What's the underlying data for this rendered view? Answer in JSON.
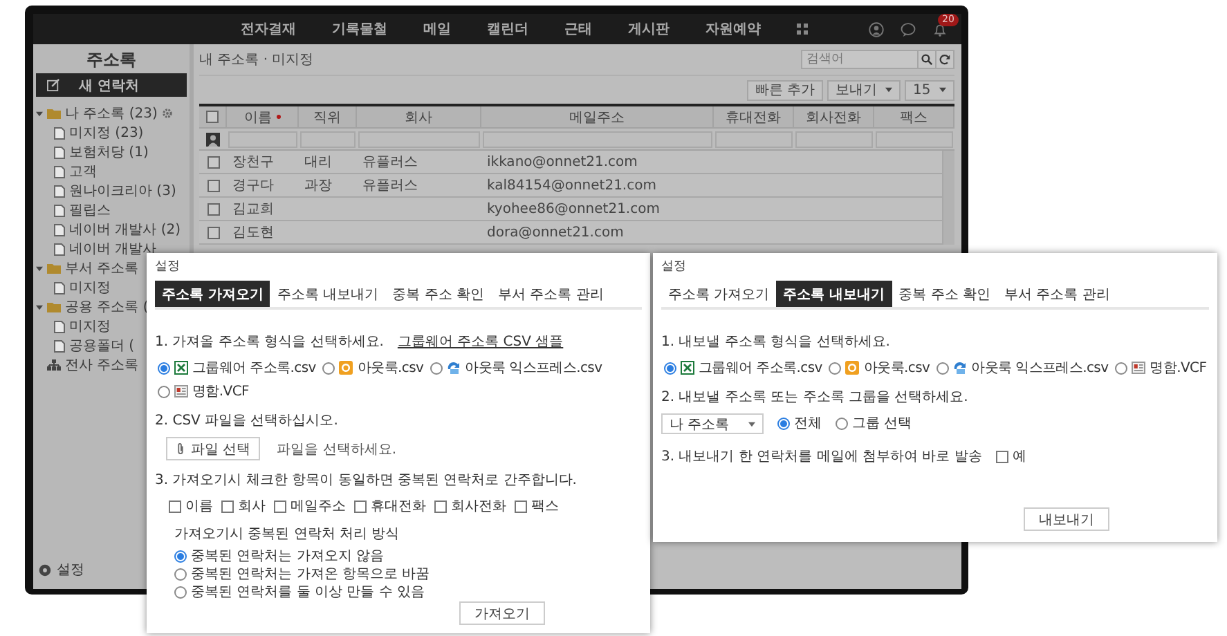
{
  "nav": {
    "items": [
      "전자결재",
      "기록물철",
      "메일",
      "캘린더",
      "근태",
      "게시판",
      "자원예약"
    ],
    "badge": "20"
  },
  "sidebar": {
    "title": "주소록",
    "new_button": "새 연락처",
    "tree": [
      {
        "label": "나 주소록 (23)",
        "kind": "folder",
        "expanded": true,
        "settings": true,
        "children": [
          {
            "label": "미지정 (23)"
          },
          {
            "label": "보험처당 (1)"
          },
          {
            "label": "고객"
          },
          {
            "label": "원나이크리아 (3)"
          },
          {
            "label": "필립스"
          },
          {
            "label": "네이버 개발사 (2)"
          },
          {
            "label": "네이버 개발사"
          }
        ]
      },
      {
        "label": "부서 주소록",
        "kind": "folder",
        "expanded": true,
        "children": [
          {
            "label": "미지정"
          }
        ]
      },
      {
        "label": "공용 주소록 (",
        "kind": "folder",
        "expanded": true,
        "children": [
          {
            "label": "미지정"
          },
          {
            "label": "공용폴더 ("
          }
        ]
      },
      {
        "label": "전사 주소록",
        "kind": "org"
      }
    ],
    "footer": "설정"
  },
  "breadcrumb": "내 주소록 · 미지정",
  "search": {
    "placeholder": "검색어"
  },
  "toolbar": {
    "buttons": [
      "빠른 추가",
      "보내기"
    ],
    "page_size": "15"
  },
  "table": {
    "all_checked": false,
    "columns": [
      {
        "label": "이름",
        "sorted": true
      },
      {
        "label": "직위",
        "sorted": false
      },
      {
        "label": "회사",
        "sorted": false
      },
      {
        "label": "메일주소",
        "sorted": false
      },
      {
        "label": "휴대전화",
        "sorted": false
      },
      {
        "label": "회사전화",
        "sorted": false
      },
      {
        "label": "팩스",
        "sorted": false
      }
    ],
    "rows": [
      {
        "checked": false,
        "cells": [
          "장천구",
          "대리",
          "유플러스",
          "ikkano@onnet21.com",
          "",
          "",
          ""
        ]
      },
      {
        "checked": false,
        "cells": [
          "경구다",
          "과장",
          "유플러스",
          "kal84154@onnet21.com",
          "",
          "",
          ""
        ]
      },
      {
        "checked": false,
        "cells": [
          "김교희",
          "",
          "",
          "kyohee86@onnet21.com",
          "",
          "",
          ""
        ]
      },
      {
        "checked": false,
        "cells": [
          "김도현",
          "",
          "",
          "dora@onnet21.com",
          "",
          "",
          ""
        ]
      }
    ]
  },
  "dialogs": [
    {
      "kind": "import",
      "title": "설정",
      "tabs": [
        {
          "label": "주소록 가져오기",
          "selected": true
        },
        {
          "label": "주소록 내보내기",
          "selected": false
        },
        {
          "label": "중복 주소 확인",
          "selected": false
        },
        {
          "label": "부서 주소록 관리",
          "selected": false
        }
      ],
      "step1": {
        "label": "1. 가져올 주소록 형식을 선택하세요.",
        "link": "그룹웨어 주소록 CSV 샘플",
        "formats": [
          {
            "label": "그룹웨어 주소록.csv",
            "kind": "excel",
            "selected": true
          },
          {
            "label": "아웃룩.csv",
            "kind": "outlook",
            "selected": false
          },
          {
            "label": "아웃룩 익스프레스.csv",
            "kind": "express",
            "selected": false
          },
          {
            "label": "명함.VCF",
            "kind": "vcard",
            "selected": false
          }
        ]
      },
      "step2": {
        "label": "2. CSV 파일을 선택하십시오.",
        "button": "파일 선택",
        "file_hint": "파일을 선택하세요."
      },
      "step3": {
        "label": "3. 가져오기시 체크한 항목이 동일하면 중복된 연락처로 간주합니다.",
        "fields": [
          {
            "label": "이름",
            "checked": false
          },
          {
            "label": "회사",
            "checked": false
          },
          {
            "label": "메일주소",
            "checked": false
          },
          {
            "label": "휴대전화",
            "checked": false
          },
          {
            "label": "회사전화",
            "checked": false
          },
          {
            "label": "팩스",
            "checked": false
          }
        ],
        "mode_label": "가져오기시 중복된 연락처 처리 방식",
        "modes": [
          {
            "label": "중복된 연락처는 가져오지 않음",
            "selected": true
          },
          {
            "label": "중복된 연락처는 가져온 항목으로 바꿈",
            "selected": false
          },
          {
            "label": "중복된 연락처를 둘 이상 만들 수 있음",
            "selected": false
          }
        ]
      },
      "submit": "가져오기"
    },
    {
      "kind": "export",
      "title": "설정",
      "tabs": [
        {
          "label": "주소록 가져오기",
          "selected": false
        },
        {
          "label": "주소록 내보내기",
          "selected": true
        },
        {
          "label": "중복 주소 확인",
          "selected": false
        },
        {
          "label": "부서 주소록 관리",
          "selected": false
        }
      ],
      "step1": {
        "label": "1. 내보낼 주소록 형식을 선택하세요.",
        "formats": [
          {
            "label": "그룹웨어 주소록.csv",
            "kind": "excel",
            "selected": true
          },
          {
            "label": "아웃룩.csv",
            "kind": "outlook",
            "selected": false
          },
          {
            "label": "아웃룩 익스프레스.csv",
            "kind": "express",
            "selected": false
          },
          {
            "label": "명함.VCF",
            "kind": "vcard",
            "selected": false
          }
        ]
      },
      "step2": {
        "label": "2. 내보낼 주소록 또는 주소록 그룹을 선택하세요.",
        "select": "나 주소록",
        "scopes": [
          {
            "label": "전체",
            "selected": true
          },
          {
            "label": "그룹 선택",
            "selected": false
          }
        ]
      },
      "step3": {
        "label": "3. 내보내기 한 연락처를 메일에 첨부하여 바로 발송",
        "option": {
          "label": "예",
          "checked": false
        }
      },
      "submit": "내보내기"
    }
  ]
}
